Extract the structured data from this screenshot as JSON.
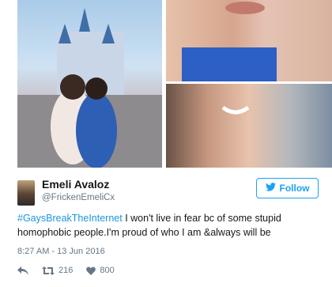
{
  "tweet": {
    "display_name": "Emeli Avaloz",
    "handle": "@FrickenEmeliCx",
    "follow_label": "Follow",
    "hashtag": "#GaysBreakTheInternet",
    "text_line1": " I won't live in fear bc of some stupid",
    "text_line2": "homophobic people.I'm proud of who I am &always will be",
    "timestamp": "8:27 AM - 13 Jun 2016",
    "retweet_count": "216",
    "like_count": "800"
  },
  "icons": {
    "follow": "twitter-bird-icon",
    "reply": "reply-icon",
    "retweet": "retweet-icon",
    "like": "heart-icon"
  },
  "colors": {
    "accent": "#1da1f2",
    "hashtag": "#1b95e0",
    "meta": "#657786"
  }
}
